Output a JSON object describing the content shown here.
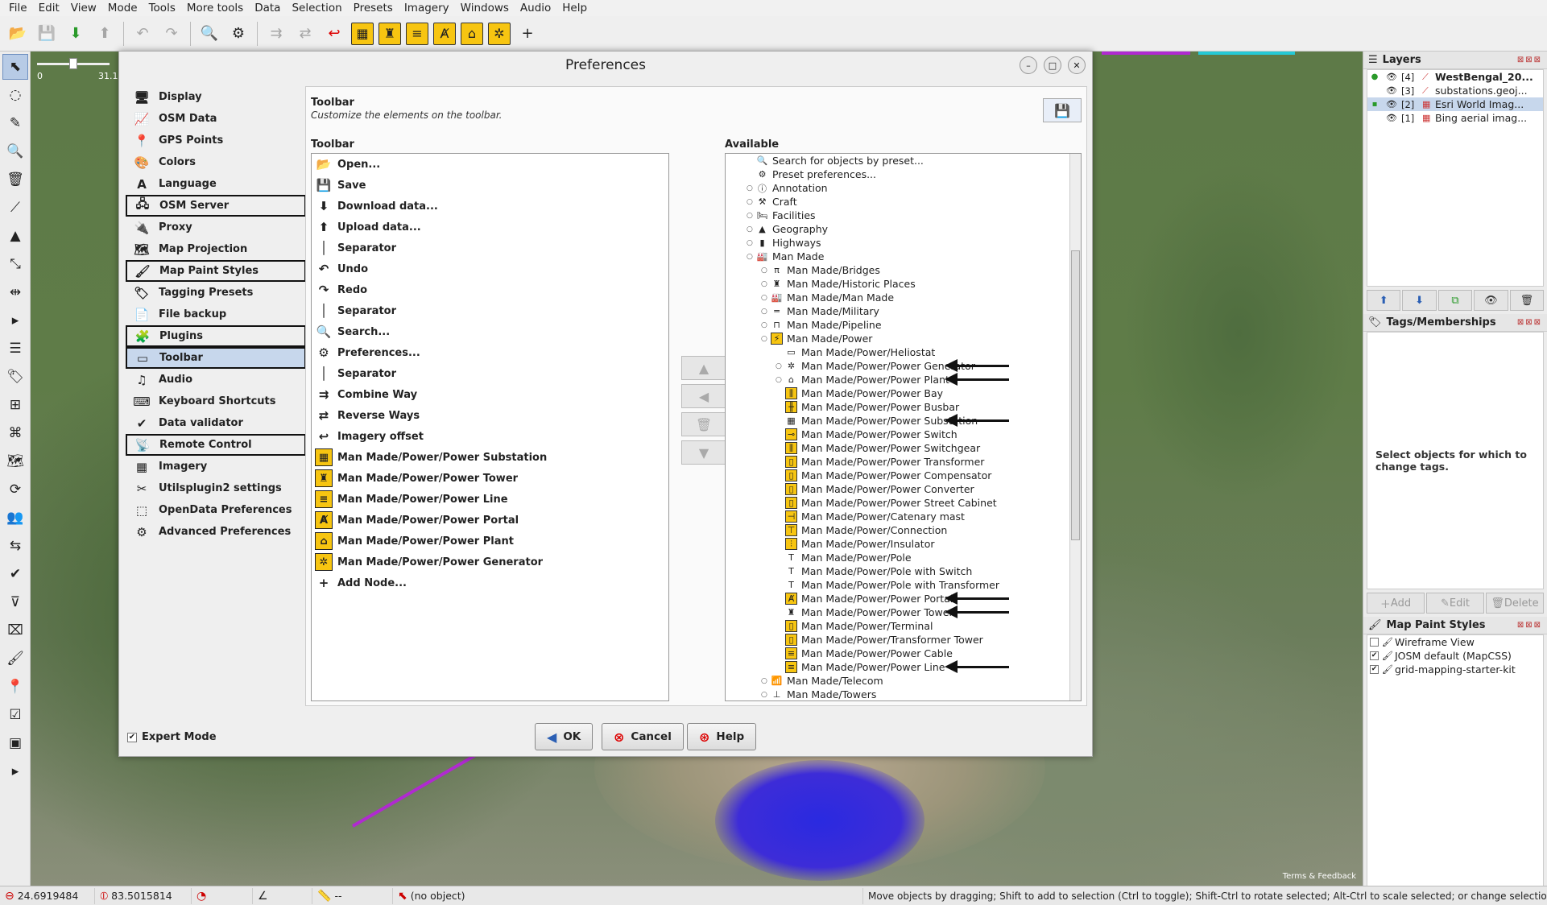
{
  "menu": [
    "File",
    "Edit",
    "View",
    "Mode",
    "Tools",
    "More tools",
    "Data",
    "Selection",
    "Presets",
    "Imagery",
    "Windows",
    "Audio",
    "Help"
  ],
  "map": {
    "scale_zero": "0",
    "scale_mark": "31.1",
    "terms": "Terms & Feedback"
  },
  "status": {
    "lat": "24.6919484",
    "lon": "83.5015814",
    "angle": "--",
    "object": "(no object)",
    "help": "Move objects by dragging; Shift to add to selection (Ctrl to toggle); Shift-Ctrl to rotate selected; Alt-Ctrl to scale selected; or change selection"
  },
  "layers": {
    "title": "Layers",
    "items": [
      {
        "num": "[4]",
        "name": "WestBengal_20..."
      },
      {
        "num": "[3]",
        "name": "substations.geoj..."
      },
      {
        "num": "[2]",
        "name": "Esri World Imag..."
      },
      {
        "num": "[1]",
        "name": "Bing aerial imag..."
      }
    ]
  },
  "tags": {
    "title": "Tags/Memberships",
    "empty": "Select objects for which to change tags.",
    "add": "Add",
    "edit": "Edit",
    "delete": "Delete"
  },
  "mapstyles": {
    "title": "Map Paint Styles",
    "items": [
      "Wireframe View",
      "JOSM default (MapCSS)",
      "grid-mapping-starter-kit"
    ]
  },
  "dialog": {
    "title": "Preferences",
    "categories": [
      {
        "label": "Display",
        "icon": "🖥"
      },
      {
        "label": "OSM Data",
        "icon": "📈"
      },
      {
        "label": "GPS Points",
        "icon": "📍"
      },
      {
        "label": "Colors",
        "icon": "🎨"
      },
      {
        "label": "Language",
        "icon": "A"
      },
      {
        "label": "OSM Server",
        "icon": "🖧"
      },
      {
        "label": "Proxy",
        "icon": "🔌"
      },
      {
        "label": "Map Projection",
        "icon": "🗺"
      },
      {
        "label": "Map Paint Styles",
        "icon": "🖌"
      },
      {
        "label": "Tagging Presets",
        "icon": "🏷"
      },
      {
        "label": "File backup",
        "icon": "📄"
      },
      {
        "label": "Plugins",
        "icon": "🧩"
      },
      {
        "label": "Toolbar",
        "icon": "▭"
      },
      {
        "label": "Audio",
        "icon": "♫"
      },
      {
        "label": "Keyboard Shortcuts",
        "icon": "⌨"
      },
      {
        "label": "Data validator",
        "icon": "✔"
      },
      {
        "label": "Remote Control",
        "icon": "📡"
      },
      {
        "label": "Imagery",
        "icon": "▦"
      },
      {
        "label": "Utilsplugin2 settings",
        "icon": "✂"
      },
      {
        "label": "OpenData Preferences",
        "icon": "⬚"
      },
      {
        "label": "Advanced Preferences",
        "icon": "⚙"
      }
    ],
    "panel_title": "Toolbar",
    "panel_desc": "Customize the elements on the toolbar.",
    "toolbar_label": "Toolbar",
    "available_label": "Available",
    "toolbar_items": [
      {
        "label": "Open...",
        "icon": "📂"
      },
      {
        "label": "Save",
        "icon": "💾"
      },
      {
        "label": "Download data...",
        "icon": "⬇"
      },
      {
        "label": "Upload data...",
        "icon": "⬆"
      },
      {
        "label": "Separator",
        "icon": "│"
      },
      {
        "label": "Undo",
        "icon": "↶"
      },
      {
        "label": "Redo",
        "icon": "↷"
      },
      {
        "label": "Separator",
        "icon": "│"
      },
      {
        "label": "Search...",
        "icon": "🔍"
      },
      {
        "label": "Preferences...",
        "icon": "⚙"
      },
      {
        "label": "Separator",
        "icon": "│"
      },
      {
        "label": "Combine Way",
        "icon": "⇉"
      },
      {
        "label": "Reverse Ways",
        "icon": "⇄"
      },
      {
        "label": "Imagery offset",
        "icon": "↩"
      },
      {
        "label": "Man Made/Power/Power Substation",
        "icon": "▦",
        "y": true
      },
      {
        "label": "Man Made/Power/Power Tower",
        "icon": "♜",
        "y": true
      },
      {
        "label": "Man Made/Power/Power Line",
        "icon": "≡",
        "y": true
      },
      {
        "label": "Man Made/Power/Power Portal",
        "icon": "Ⱥ",
        "y": true
      },
      {
        "label": "Man Made/Power/Power Plant",
        "icon": "⌂",
        "y": true
      },
      {
        "label": "Man Made/Power/Power Generator",
        "icon": "✲",
        "y": true
      },
      {
        "label": "Add Node...",
        "icon": "+"
      }
    ],
    "available_items": [
      {
        "label": "Search for objects by preset...",
        "indent": 1,
        "ex": "",
        "icon": "🔍"
      },
      {
        "label": "Preset preferences...",
        "indent": 1,
        "ex": "",
        "icon": "⚙"
      },
      {
        "label": "Annotation",
        "indent": 1,
        "ex": "○",
        "icon": "ⓘ"
      },
      {
        "label": "Craft",
        "indent": 1,
        "ex": "○",
        "icon": "⚒"
      },
      {
        "label": "Facilities",
        "indent": 1,
        "ex": "○",
        "icon": "🛏"
      },
      {
        "label": "Geography",
        "indent": 1,
        "ex": "○",
        "icon": "▲"
      },
      {
        "label": "Highways",
        "indent": 1,
        "ex": "○",
        "icon": "▮"
      },
      {
        "label": "Man Made",
        "indent": 1,
        "ex": "○",
        "icon": "🏭"
      },
      {
        "label": "Man Made/Bridges",
        "indent": 2,
        "ex": "○",
        "icon": "π"
      },
      {
        "label": "Man Made/Historic Places",
        "indent": 2,
        "ex": "○",
        "icon": "♜"
      },
      {
        "label": "Man Made/Man Made",
        "indent": 2,
        "ex": "○",
        "icon": "🏭"
      },
      {
        "label": "Man Made/Military",
        "indent": 2,
        "ex": "○",
        "icon": "═"
      },
      {
        "label": "Man Made/Pipeline",
        "indent": 2,
        "ex": "○",
        "icon": "⊓"
      },
      {
        "label": "Man Made/Power",
        "indent": 2,
        "ex": "○",
        "icon": "⚡",
        "y": true
      },
      {
        "label": "Man Made/Power/Heliostat",
        "indent": 3,
        "ex": "",
        "icon": "▭"
      },
      {
        "label": "Man Made/Power/Power Generator",
        "indent": 3,
        "ex": "○",
        "icon": "✲",
        "arrow": true
      },
      {
        "label": "Man Made/Power/Power Plant",
        "indent": 3,
        "ex": "○",
        "icon": "⌂",
        "arrow": true
      },
      {
        "label": "Man Made/Power/Power Bay",
        "indent": 3,
        "ex": "",
        "icon": "⫼",
        "y": true
      },
      {
        "label": "Man Made/Power/Power Busbar",
        "indent": 3,
        "ex": "",
        "icon": "╫",
        "y": true
      },
      {
        "label": "Man Made/Power/Power Substation",
        "indent": 3,
        "ex": "",
        "icon": "▦",
        "arrow": true
      },
      {
        "label": "Man Made/Power/Power Switch",
        "indent": 3,
        "ex": "",
        "icon": "⊸",
        "y": true
      },
      {
        "label": "Man Made/Power/Power Switchgear",
        "indent": 3,
        "ex": "",
        "icon": "⫼",
        "y": true
      },
      {
        "label": "Man Made/Power/Power Transformer",
        "indent": 3,
        "ex": "",
        "icon": "▯",
        "y": true
      },
      {
        "label": "Man Made/Power/Power Compensator",
        "indent": 3,
        "ex": "",
        "icon": "▯",
        "y": true
      },
      {
        "label": "Man Made/Power/Power Converter",
        "indent": 3,
        "ex": "",
        "icon": "▯",
        "y": true
      },
      {
        "label": "Man Made/Power/Power Street Cabinet",
        "indent": 3,
        "ex": "",
        "icon": "▯",
        "y": true
      },
      {
        "label": "Man Made/Power/Catenary mast",
        "indent": 3,
        "ex": "",
        "icon": "⊣",
        "y": true
      },
      {
        "label": "Man Made/Power/Connection",
        "indent": 3,
        "ex": "",
        "icon": "⊤",
        "y": true
      },
      {
        "label": "Man Made/Power/Insulator",
        "indent": 3,
        "ex": "",
        "icon": "⫶",
        "y": true
      },
      {
        "label": "Man Made/Power/Pole",
        "indent": 3,
        "ex": "",
        "icon": "T"
      },
      {
        "label": "Man Made/Power/Pole with Switch",
        "indent": 3,
        "ex": "",
        "icon": "T"
      },
      {
        "label": "Man Made/Power/Pole with Transformer",
        "indent": 3,
        "ex": "",
        "icon": "T"
      },
      {
        "label": "Man Made/Power/Power Portal",
        "indent": 3,
        "ex": "",
        "icon": "Ⱥ",
        "y": true,
        "arrow": true
      },
      {
        "label": "Man Made/Power/Power Tower",
        "indent": 3,
        "ex": "",
        "icon": "♜",
        "arrow": true
      },
      {
        "label": "Man Made/Power/Terminal",
        "indent": 3,
        "ex": "",
        "icon": "▯",
        "y": true
      },
      {
        "label": "Man Made/Power/Transformer Tower",
        "indent": 3,
        "ex": "",
        "icon": "▯",
        "y": true
      },
      {
        "label": "Man Made/Power/Power Cable",
        "indent": 3,
        "ex": "",
        "icon": "≡",
        "y": true
      },
      {
        "label": "Man Made/Power/Power Line",
        "indent": 3,
        "ex": "",
        "icon": "≡",
        "y": true,
        "arrow": true
      },
      {
        "label": "Man Made/Telecom",
        "indent": 2,
        "ex": "○",
        "icon": "📶"
      },
      {
        "label": "Man Made/Towers",
        "indent": 2,
        "ex": "○",
        "icon": "⊥"
      }
    ],
    "expert_mode": "Expert Mode",
    "ok": "OK",
    "cancel": "Cancel",
    "help": "Help"
  }
}
